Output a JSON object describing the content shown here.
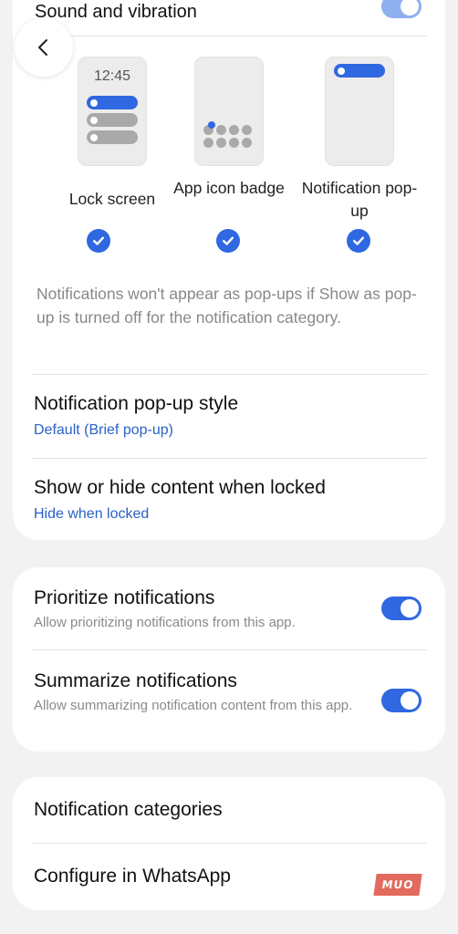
{
  "cut_row": {
    "title": "Sound and vibration"
  },
  "options": [
    {
      "thumb_time": "12:45",
      "label": "Lock screen",
      "checked": true
    },
    {
      "label": "App icon badge",
      "checked": true
    },
    {
      "label": "Notification pop-up",
      "checked": true
    }
  ],
  "info": "Notifications won't appear as pop-ups if Show as pop-up is turned off for the notification category.",
  "rows": {
    "popup_style": {
      "title": "Notification pop-up style",
      "value": "Default (Brief pop-up)"
    },
    "lock_content": {
      "title": "Show or hide content when locked",
      "value": "Hide when locked"
    },
    "prioritize": {
      "title": "Prioritize notifications",
      "subtitle": "Allow prioritizing notifications from this app.",
      "enabled": true
    },
    "summarize": {
      "title": "Summarize notifications",
      "subtitle": "Allow summarizing notification content from this app.",
      "enabled": true
    },
    "categories": {
      "title": "Notification categories"
    },
    "configure": {
      "title": "Configure in WhatsApp"
    }
  },
  "watermark": "MUO",
  "colors": {
    "accent": "#2f68e0",
    "link": "#2a61c6",
    "background": "#f2f2f2",
    "card": "#ffffff"
  },
  "icons": {
    "back": "chevron-left-icon",
    "check": "check-circle-icon"
  }
}
